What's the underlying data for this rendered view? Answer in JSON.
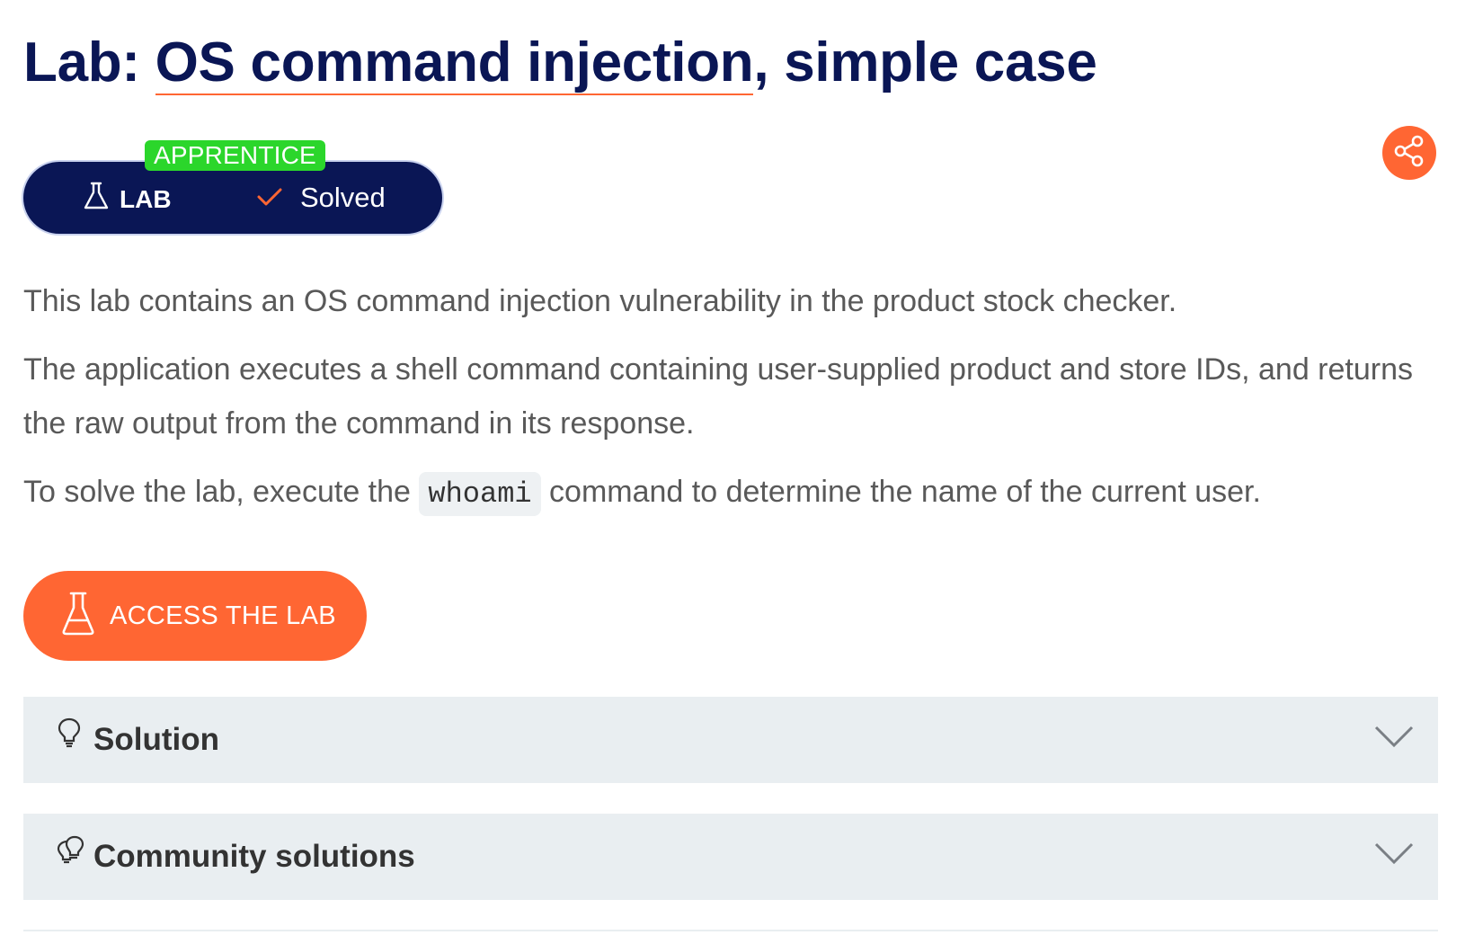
{
  "title": {
    "prefix": "Lab: ",
    "topic": "OS command injection",
    "suffix": ", simple case"
  },
  "badge": {
    "level": "APPRENTICE",
    "type_label": "LAB",
    "status": "Solved"
  },
  "description": {
    "p1": "This lab contains an OS command injection vulnerability in the product stock checker.",
    "p2": "The application executes a shell command containing user-supplied product and store IDs, and returns the raw output from the command in its response.",
    "p3_before": "To solve the lab, execute the ",
    "p3_code": "whoami",
    "p3_after": " command to determine the name of the current user."
  },
  "access_button": {
    "label": "ACCESS THE LAB"
  },
  "accordions": [
    {
      "label": "Solution",
      "icon": "lightbulb-icon"
    },
    {
      "label": "Community solutions",
      "icon": "double-lightbulb-icon"
    }
  ],
  "colors": {
    "navy": "#0a1655",
    "accent": "#ff6633",
    "level_green": "#2bd62b",
    "panel_gray": "#e9eef1",
    "body_text": "#595959"
  }
}
